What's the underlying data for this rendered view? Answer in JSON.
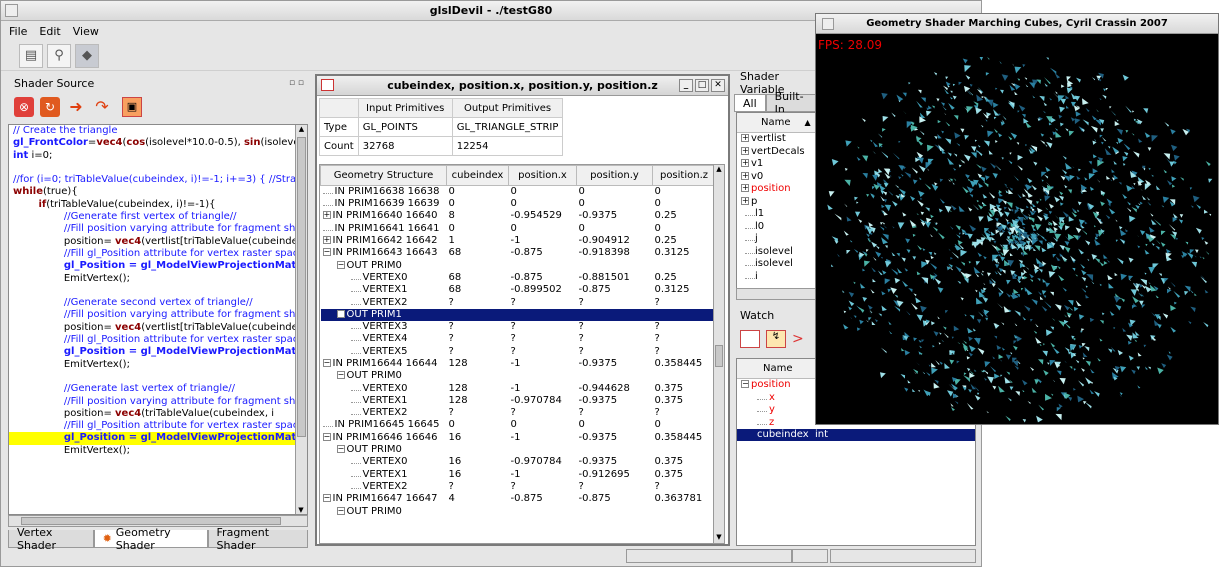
{
  "main_window": {
    "title": "glslDevil - ./testG80",
    "menu": [
      "File",
      "Edit",
      "View"
    ]
  },
  "shader_source": {
    "title": "Shader Source",
    "lines": [
      {
        "parts": [
          {
            "t": "// Create the triangle",
            "c": "blue"
          }
        ]
      },
      {
        "parts": [
          {
            "t": "gl_FrontColor",
            "c": "kwb"
          },
          {
            "t": "=",
            "c": ""
          },
          {
            "t": "vec4",
            "c": "kw"
          },
          {
            "t": "(",
            "c": ""
          },
          {
            "t": "cos",
            "c": "kw"
          },
          {
            "t": "(isolevel*10.0-0.5), ",
            "c": ""
          },
          {
            "t": "sin",
            "c": "kw"
          },
          {
            "t": "(isoleve",
            "c": ""
          }
        ]
      },
      {
        "parts": [
          {
            "t": "int",
            "c": "kwb"
          },
          {
            "t": " i=0;",
            "c": ""
          }
        ]
      },
      {
        "parts": [
          {
            "t": "",
            "c": ""
          }
        ]
      },
      {
        "parts": [
          {
            "t": "//for (i=0; triTableValue(cubeindex, i)!=-1; i+=3) { //Stran",
            "c": "blue"
          }
        ]
      },
      {
        "parts": [
          {
            "t": "while",
            "c": "kw"
          },
          {
            "t": "(true){",
            "c": ""
          }
        ]
      },
      {
        "parts": [
          {
            "t": "        ",
            "c": ""
          },
          {
            "t": "if",
            "c": "kw"
          },
          {
            "t": "(triTableValue(cubeindex, i)!=-1){",
            "c": ""
          }
        ]
      },
      {
        "parts": [
          {
            "t": "                //Generate first vertex of triangle//",
            "c": "blue"
          }
        ]
      },
      {
        "parts": [
          {
            "t": "                //Fill position varying attribute for fragment shade",
            "c": "blue"
          }
        ]
      },
      {
        "parts": [
          {
            "t": "                position= ",
            "c": ""
          },
          {
            "t": "vec4",
            "c": "kw"
          },
          {
            "t": "(vertlist[triTableValue(cubeindex, i",
            "c": ""
          }
        ]
      },
      {
        "parts": [
          {
            "t": "                //Fill gl_Position attribute for vertex raster space p",
            "c": "blue"
          }
        ]
      },
      {
        "parts": [
          {
            "t": "                ",
            "c": ""
          },
          {
            "t": "gl_Position = gl_ModelViewProjectionMatri",
            "c": "kwb"
          }
        ]
      },
      {
        "parts": [
          {
            "t": "                EmitVertex();",
            "c": ""
          }
        ]
      },
      {
        "parts": [
          {
            "t": "",
            "c": ""
          }
        ]
      },
      {
        "parts": [
          {
            "t": "                //Generate second vertex of triangle//",
            "c": "blue"
          }
        ]
      },
      {
        "parts": [
          {
            "t": "                //Fill position varying attribute for fragment shade",
            "c": "blue"
          }
        ]
      },
      {
        "parts": [
          {
            "t": "                position= ",
            "c": ""
          },
          {
            "t": "vec4",
            "c": "kw"
          },
          {
            "t": "(vertlist[triTableValue(cubeindex, i",
            "c": ""
          }
        ]
      },
      {
        "parts": [
          {
            "t": "                //Fill gl_Position attribute for vertex raster space p",
            "c": "blue"
          }
        ]
      },
      {
        "parts": [
          {
            "t": "                ",
            "c": ""
          },
          {
            "t": "gl_Position = gl_ModelViewProjectionMatri",
            "c": "kwb"
          }
        ]
      },
      {
        "parts": [
          {
            "t": "                EmitVertex();",
            "c": ""
          }
        ]
      },
      {
        "parts": [
          {
            "t": "",
            "c": ""
          }
        ]
      },
      {
        "parts": [
          {
            "t": "                //Generate last vertex of triangle//",
            "c": "blue"
          }
        ]
      },
      {
        "parts": [
          {
            "t": "                //Fill position varying attribute for fragment shade",
            "c": "blue"
          }
        ]
      },
      {
        "parts": [
          {
            "t": "                position= ",
            "c": ""
          },
          {
            "t": "vec4",
            "c": "kw"
          },
          {
            "t": "(triTableValue(cubeindex, i",
            "c": ""
          }
        ]
      },
      {
        "parts": [
          {
            "t": "                //Fill gl_Position attribute for vertex raster space p",
            "c": "blue"
          }
        ]
      },
      {
        "parts": [
          {
            "t": "                ",
            "c": ""
          },
          {
            "t": "gl_Position = gl_ModelViewProjectionMatri",
            "c": "kwb"
          }
        ],
        "highlight": true
      },
      {
        "parts": [
          {
            "t": "                EmitVertex();",
            "c": ""
          }
        ]
      }
    ],
    "tabs": [
      "Vertex Shader",
      "Geometry Shader",
      "Fragment Shader"
    ]
  },
  "popup": {
    "title": "cubeindex, position.x, position.y, position.z",
    "summary_headers": [
      "",
      "Input Primitives",
      "Output Primitives"
    ],
    "summary_rows": [
      [
        "Type",
        "GL_POINTS",
        "GL_TRIANGLE_STRIP"
      ],
      [
        "Count",
        "32768",
        "12254"
      ]
    ],
    "columns": [
      "Geometry Structure",
      "cubeindex",
      "position.x",
      "position.y",
      "position.z"
    ],
    "rows": [
      {
        "lvl": 0,
        "exp": "",
        "name": "IN PRIM16638 16638",
        "v": [
          "0",
          "0",
          "0",
          "0"
        ]
      },
      {
        "lvl": 0,
        "exp": "",
        "name": "IN PRIM16639 16639",
        "v": [
          "0",
          "0",
          "0",
          "0"
        ]
      },
      {
        "lvl": 0,
        "exp": "+",
        "name": "IN PRIM16640 16640",
        "v": [
          "8",
          "-0.954529",
          "-0.9375",
          "0.25"
        ]
      },
      {
        "lvl": 0,
        "exp": "",
        "name": "IN PRIM16641 16641",
        "v": [
          "0",
          "0",
          "0",
          "0"
        ]
      },
      {
        "lvl": 0,
        "exp": "+",
        "name": "IN PRIM16642 16642",
        "v": [
          "1",
          "-1",
          "-0.904912",
          "0.25"
        ]
      },
      {
        "lvl": 0,
        "exp": "-",
        "name": "IN PRIM16643 16643",
        "v": [
          "68",
          "-0.875",
          "-0.918398",
          "0.3125"
        ]
      },
      {
        "lvl": 1,
        "exp": "-",
        "name": "OUT PRIM0",
        "v": [
          "",
          "",
          "",
          ""
        ]
      },
      {
        "lvl": 2,
        "exp": "",
        "name": "VERTEX0",
        "v": [
          "68",
          "-0.875",
          "-0.881501",
          "0.25"
        ]
      },
      {
        "lvl": 2,
        "exp": "",
        "name": "VERTEX1",
        "v": [
          "68",
          "-0.899502",
          "-0.875",
          "0.3125"
        ]
      },
      {
        "lvl": 2,
        "exp": "",
        "name": "VERTEX2",
        "v": [
          "?",
          "?",
          "?",
          "?"
        ]
      },
      {
        "lvl": 1,
        "exp": "-",
        "name": "OUT PRIM1",
        "v": [
          "",
          "",
          "",
          ""
        ],
        "sel": true
      },
      {
        "lvl": 2,
        "exp": "",
        "name": "VERTEX3",
        "v": [
          "?",
          "?",
          "?",
          "?"
        ]
      },
      {
        "lvl": 2,
        "exp": "",
        "name": "VERTEX4",
        "v": [
          "?",
          "?",
          "?",
          "?"
        ]
      },
      {
        "lvl": 2,
        "exp": "",
        "name": "VERTEX5",
        "v": [
          "?",
          "?",
          "?",
          "?"
        ]
      },
      {
        "lvl": 0,
        "exp": "-",
        "name": "IN PRIM16644 16644",
        "v": [
          "128",
          "-1",
          "-0.9375",
          "0.358445"
        ]
      },
      {
        "lvl": 1,
        "exp": "-",
        "name": "OUT PRIM0",
        "v": [
          "",
          "",
          "",
          ""
        ]
      },
      {
        "lvl": 2,
        "exp": "",
        "name": "VERTEX0",
        "v": [
          "128",
          "-1",
          "-0.944628",
          "0.375"
        ]
      },
      {
        "lvl": 2,
        "exp": "",
        "name": "VERTEX1",
        "v": [
          "128",
          "-0.970784",
          "-0.9375",
          "0.375"
        ]
      },
      {
        "lvl": 2,
        "exp": "",
        "name": "VERTEX2",
        "v": [
          "?",
          "?",
          "?",
          "?"
        ]
      },
      {
        "lvl": 0,
        "exp": "",
        "name": "IN PRIM16645 16645",
        "v": [
          "0",
          "0",
          "0",
          "0"
        ]
      },
      {
        "lvl": 0,
        "exp": "-",
        "name": "IN PRIM16646 16646",
        "v": [
          "16",
          "-1",
          "-0.9375",
          "0.358445"
        ]
      },
      {
        "lvl": 1,
        "exp": "-",
        "name": "OUT PRIM0",
        "v": [
          "",
          "",
          "",
          ""
        ]
      },
      {
        "lvl": 2,
        "exp": "",
        "name": "VERTEX0",
        "v": [
          "16",
          "-0.970784",
          "-0.9375",
          "0.375"
        ]
      },
      {
        "lvl": 2,
        "exp": "",
        "name": "VERTEX1",
        "v": [
          "16",
          "-1",
          "-0.912695",
          "0.375"
        ]
      },
      {
        "lvl": 2,
        "exp": "",
        "name": "VERTEX2",
        "v": [
          "?",
          "?",
          "?",
          "?"
        ]
      },
      {
        "lvl": 0,
        "exp": "-",
        "name": "IN PRIM16647 16647",
        "v": [
          "4",
          "-0.875",
          "-0.875",
          "0.363781"
        ]
      },
      {
        "lvl": 1,
        "exp": "-",
        "name": "OUT PRIM0",
        "v": [
          "",
          "",
          "",
          ""
        ]
      }
    ]
  },
  "shader_variables": {
    "title": "Shader Variable",
    "tabs": [
      "All",
      "Built-In"
    ],
    "col": "Name",
    "items": [
      {
        "exp": "+",
        "name": "vertlist",
        "red": false
      },
      {
        "exp": "+",
        "name": "vertDecals",
        "red": false
      },
      {
        "exp": "+",
        "name": "v1",
        "red": false
      },
      {
        "exp": "+",
        "name": "v0",
        "red": false
      },
      {
        "exp": "+",
        "name": "position",
        "red": true
      },
      {
        "exp": "+",
        "name": "p",
        "red": false
      },
      {
        "exp": "",
        "name": "l1",
        "red": false
      },
      {
        "exp": "",
        "name": "l0",
        "red": false
      },
      {
        "exp": "",
        "name": "j",
        "red": false
      },
      {
        "exp": "",
        "name": "isolevel",
        "red": false
      },
      {
        "exp": "",
        "name": "isolevel",
        "red": false
      },
      {
        "exp": "",
        "name": "i",
        "red": false
      }
    ]
  },
  "watch": {
    "title": "Watch",
    "col": "Name",
    "items": [
      {
        "lvl": 0,
        "exp": "-",
        "name": "position",
        "red": true
      },
      {
        "lvl": 1,
        "exp": "",
        "name": "x",
        "red": true
      },
      {
        "lvl": 1,
        "exp": "",
        "name": "y",
        "red": true
      },
      {
        "lvl": 1,
        "exp": "",
        "name": "z",
        "red": true
      }
    ],
    "selected": {
      "name": "cubeindex",
      "type": "int"
    }
  },
  "gs_window": {
    "title": "Geometry Shader Marching Cubes, Cyril Crassin 2007",
    "fps": "FPS: 28.09"
  }
}
